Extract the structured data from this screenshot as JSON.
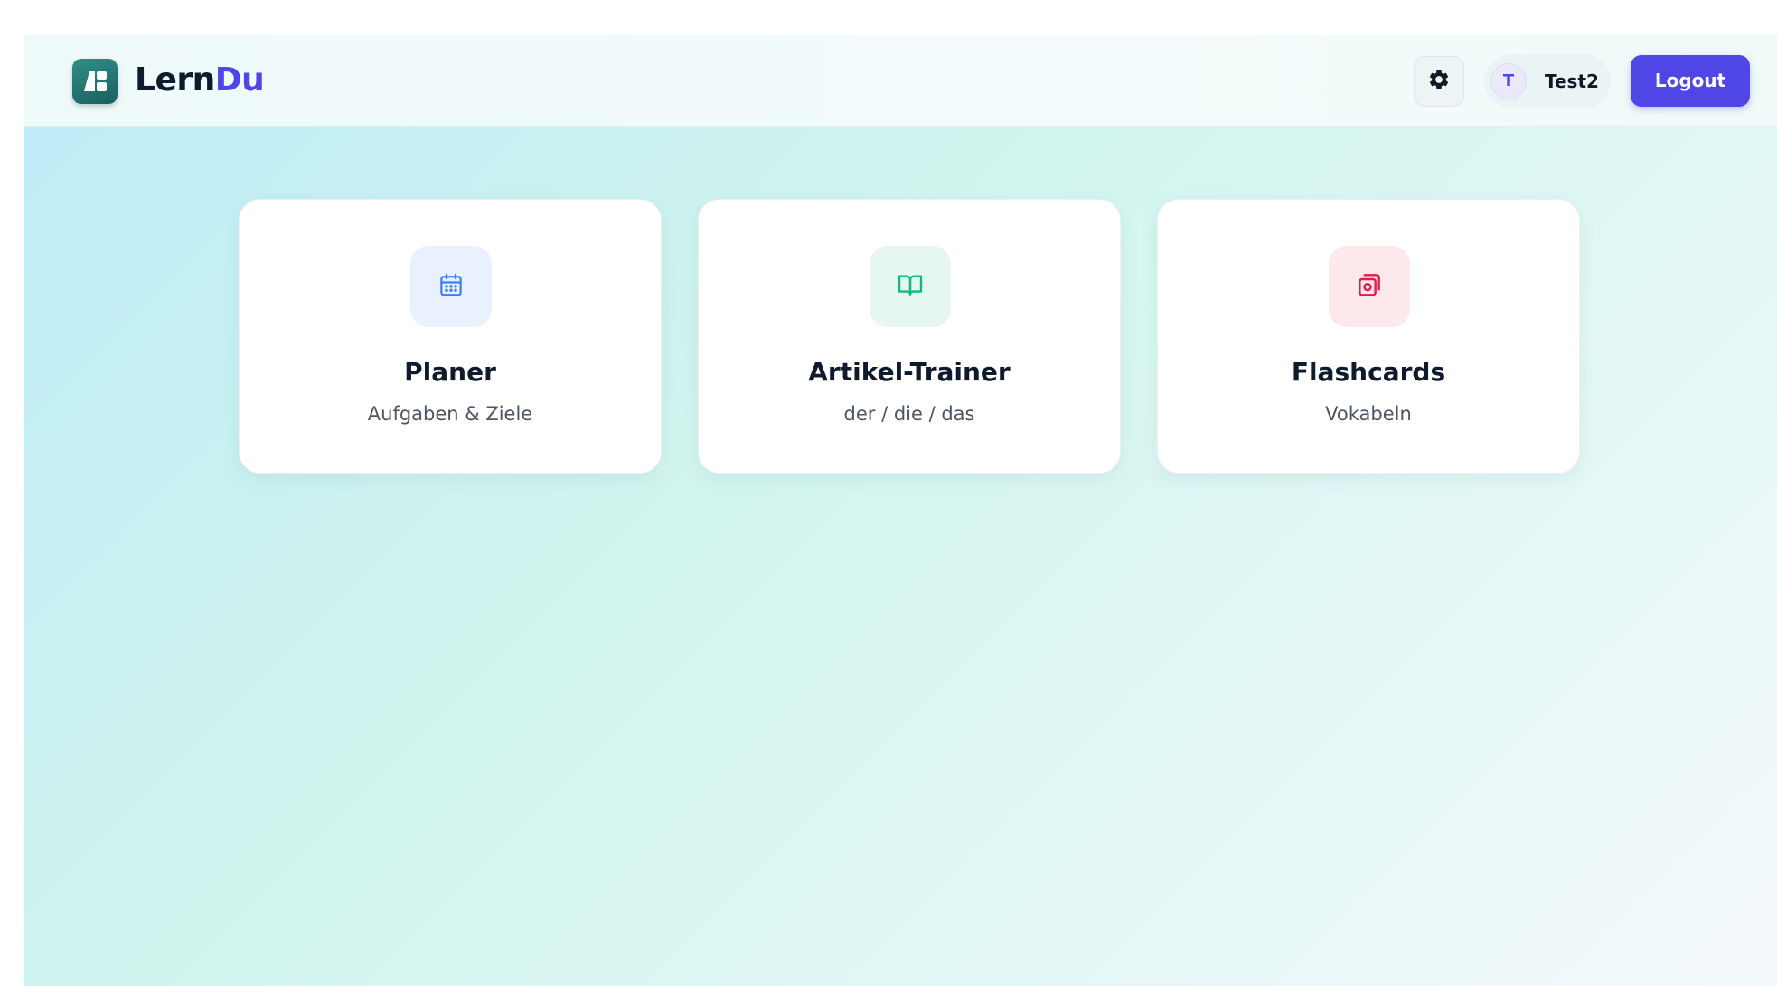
{
  "header": {
    "brand_part1": "Lern",
    "brand_part2": "Du",
    "logo_icon": "app-logo-icon",
    "settings_icon": "gear-icon",
    "user": {
      "avatar_initial": "T",
      "name": "Test2"
    },
    "logout_label": "Logout"
  },
  "cards": [
    {
      "title": "Planer",
      "subtitle": "Aufgaben & Ziele",
      "icon": "calendar-icon",
      "icon_color": "#3b82f6",
      "icon_bg": "#eaf1fe"
    },
    {
      "title": "Artikel-Trainer",
      "subtitle": "der / die / das",
      "icon": "book-open-icon",
      "icon_color": "#10b981",
      "icon_bg": "#e6f7f0"
    },
    {
      "title": "Flashcards",
      "subtitle": "Vokabeln",
      "icon": "cards-icon",
      "icon_color": "#e11d48",
      "icon_bg": "#fde8ec"
    }
  ],
  "colors": {
    "accent": "#4f46e5",
    "text_dark": "#0f1b2d",
    "text_muted": "#4b5563"
  }
}
